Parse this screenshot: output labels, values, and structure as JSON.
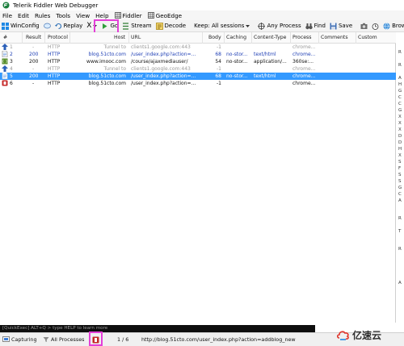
{
  "window": {
    "title": "Telerik Fiddler Web Debugger"
  },
  "menu": {
    "items": [
      "File",
      "Edit",
      "Rules",
      "Tools",
      "View",
      "Help",
      "Fiddler",
      "GeoEdge"
    ]
  },
  "toolbar": {
    "winconfig": "WinConfig",
    "replay": "Replay",
    "remove": "X",
    "go": "Go",
    "stream": "Stream",
    "decode": "Decode",
    "keep": "Keep: All sessions",
    "any_process": "Any Process",
    "find": "Find",
    "save": "Save",
    "browse": "Browse"
  },
  "grid": {
    "columns": [
      "#",
      "Result",
      "Protocol",
      "Host",
      "URL",
      "Body",
      "Caching",
      "Content-Type",
      "Process",
      "Comments",
      "Custom"
    ],
    "rows": [
      {
        "num": "1",
        "result": "-",
        "protocol": "HTTP",
        "host": "Tunnel to",
        "url": "clients1.google.com:443",
        "body": "-1",
        "caching": "",
        "ctype": "",
        "process": "chrome...",
        "style": "tunnel",
        "icon": "upload"
      },
      {
        "num": "2",
        "result": "200",
        "protocol": "HTTP",
        "host": "blog.51cto.com",
        "url": "/user_index.php?action=...",
        "body": "68",
        "caching": "no-stor...",
        "ctype": "text/html",
        "process": "chrome...",
        "style": "blue",
        "icon": "page"
      },
      {
        "num": "3",
        "result": "200",
        "protocol": "HTTP",
        "host": "www.imooc.com",
        "url": "/course/ajaxmediauser/",
        "body": "54",
        "caching": "no-stor...",
        "ctype": "application/...",
        "process": "360se:...",
        "style": "black",
        "icon": "json"
      },
      {
        "num": "4",
        "result": "-",
        "protocol": "HTTP",
        "host": "Tunnel to",
        "url": "clients1.google.com:443",
        "body": "-1",
        "caching": "",
        "ctype": "",
        "process": "chrome...",
        "style": "tunnel",
        "icon": "upload"
      },
      {
        "num": "5",
        "result": "200",
        "protocol": "HTTP",
        "host": "blog.51cto.com",
        "url": "/user_index.php?action=...",
        "body": "68",
        "caching": "no-stor...",
        "ctype": "text/html",
        "process": "chrome...",
        "style": "selected",
        "icon": "page"
      },
      {
        "num": "6",
        "result": "-",
        "protocol": "HTTP",
        "host": "blog.51cto.com",
        "url": "/user_index.php?action=...",
        "body": "-1",
        "caching": "",
        "ctype": "",
        "process": "chrome...",
        "style": "black",
        "icon": "breakpoint"
      }
    ]
  },
  "right_strip": {
    "letters": [
      "R",
      "R",
      "A",
      "H",
      "G",
      "C",
      "C",
      "G",
      "X",
      "X",
      "X",
      "D",
      "D",
      "H",
      "X",
      "S",
      "F",
      "S",
      "S",
      "G",
      "C",
      "A",
      "R",
      "T",
      "R",
      "A"
    ]
  },
  "quickexec": {
    "text": "[QuickExec] ALT+Q > type HELP to learn more"
  },
  "status": {
    "capturing": "Capturing",
    "processes": "All Processes",
    "count": "1 / 6",
    "url": "http://blog.51cto.com/user_index.php?action=addblog_new"
  },
  "watermark": {
    "text": "亿速云"
  },
  "colors": {
    "selection": "#3399ff",
    "highlight": "#e43fd8",
    "link_blue": "#1f3fb5"
  }
}
